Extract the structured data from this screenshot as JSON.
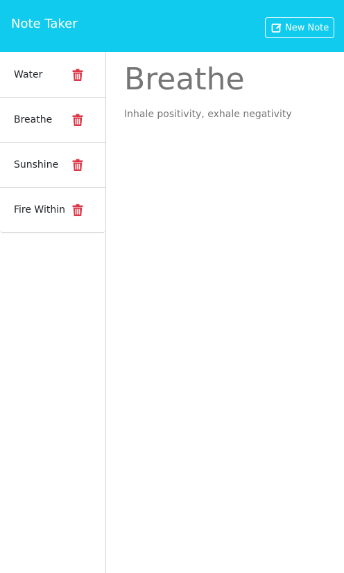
{
  "navbar": {
    "brand": "Note Taker",
    "new_note_label": "New Note",
    "new_note_icon": "edit-icon",
    "background": "#11cbef"
  },
  "notes": [
    {
      "title": "Water"
    },
    {
      "title": "Breathe"
    },
    {
      "title": "Sunshine"
    },
    {
      "title": "Fire Within"
    }
  ],
  "delete_icon": "trash-icon",
  "delete_color": "#dc3545",
  "active_note": {
    "title": "Breathe",
    "text": "Inhale positivity, exhale negativity"
  }
}
